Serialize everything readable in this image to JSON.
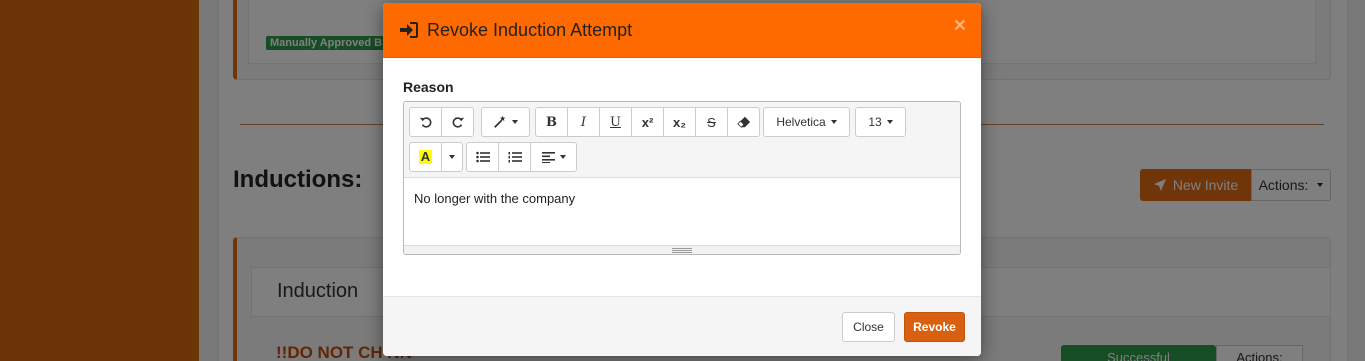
{
  "background": {
    "approved_badge": "Manually Approved B",
    "inductions_heading": "Inductions:",
    "new_invite_label": "New Invite",
    "actions_label": "Actions:",
    "induction_panel_title": "Induction",
    "warning_text": "!!DO NOT CH NN",
    "status_label": "Successful",
    "actions2_label": "Actions:"
  },
  "modal": {
    "title": "Revoke Induction Attempt",
    "close_symbol": "×",
    "reason_label": "Reason",
    "toolbar": {
      "font_name": "Helvetica",
      "font_size": "13",
      "bold": "B",
      "italic": "I",
      "underline": "U",
      "superscript": "x²",
      "subscript": "x₂",
      "strikethrough": "S",
      "highlight": "A"
    },
    "content": "No longer with the company",
    "footer": {
      "close_label": "Close",
      "revoke_label": "Revoke"
    }
  },
  "colors": {
    "header_bg": "#ff6a00",
    "revoke_bg": "#d86010",
    "sidebar_bg": "#d96a10",
    "badge_green": "#2e9b4a"
  }
}
